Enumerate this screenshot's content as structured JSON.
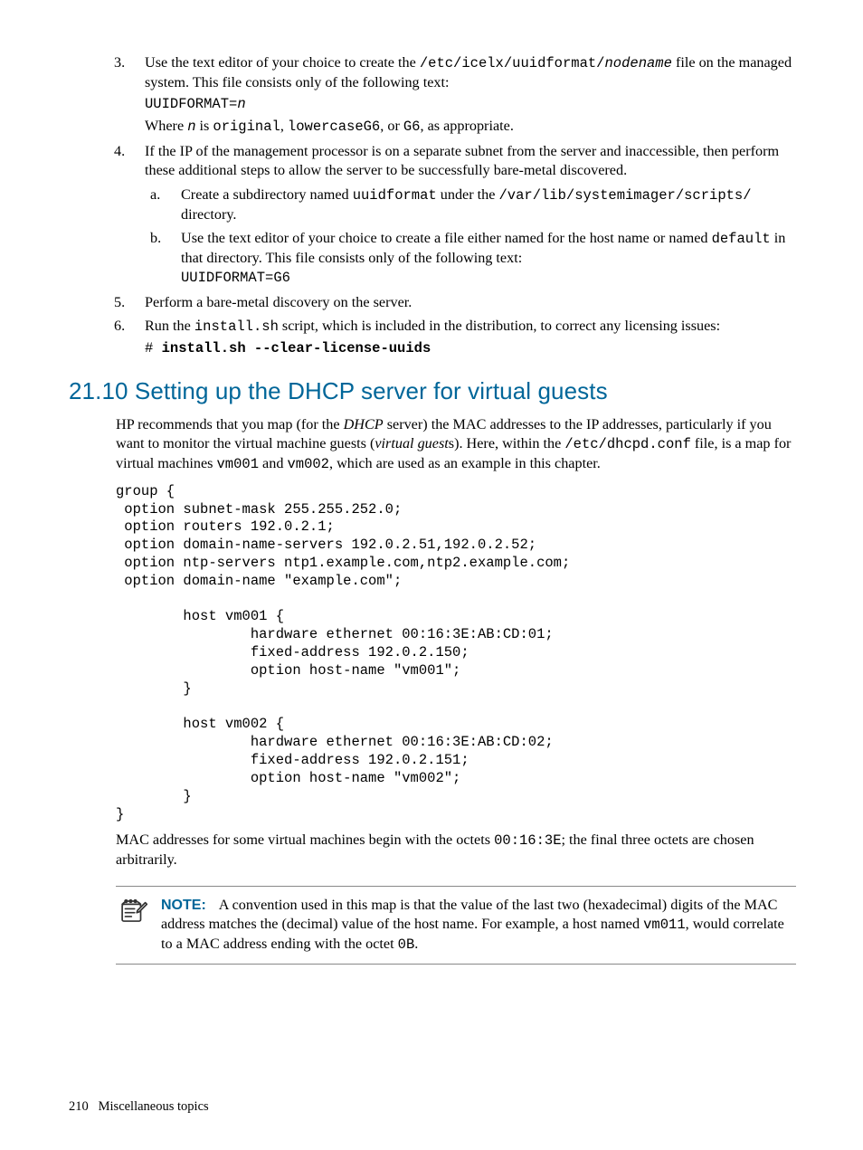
{
  "list": {
    "item3": {
      "line1_a": "Use the text editor of your choice to create the ",
      "line1_b": "/etc/icelx/uuidformat/",
      "line1_c": "nodename",
      "line1_d": " file on the managed system. This file consists only of the following text:",
      "code1_a": "UUIDFORMAT=",
      "code1_b": "n",
      "line2_a": "Where ",
      "line2_b": "n",
      "line2_c": " is ",
      "line2_d": "original",
      "line2_e": ", ",
      "line2_f": "lowercaseG6",
      "line2_g": ", or ",
      "line2_h": "G6",
      "line2_i": ", as appropriate."
    },
    "item4": {
      "intro": "If the IP of the management processor is on a separate subnet from the server and inaccessible, then perform these additional steps to allow the server to be successfully bare-metal discovered.",
      "sub_a": {
        "a": "Create a subdirectory named ",
        "b": "uuidformat",
        "c": " under the ",
        "d": "/var/lib/systemimager/scripts/",
        "e": " directory."
      },
      "sub_b": {
        "a": "Use the text editor of your choice to create a file either named for the host name or named ",
        "b": "default",
        "c": " in that directory. This file consists only of the following text:",
        "code": "UUIDFORMAT=G6"
      }
    },
    "item5": "Perform a bare-metal discovery on the server.",
    "item6": {
      "a": "Run the ",
      "b": "install.sh",
      "c": " script, which is included in the distribution, to correct any licensing issues:",
      "code_a": "# ",
      "code_b": "install.sh --clear-license-uuids"
    }
  },
  "section": {
    "heading": "21.10 Setting up the DHCP server for virtual guests",
    "p1_a": "HP recommends that you map (for the ",
    "p1_b": "DHCP",
    "p1_c": " server) the MAC addresses to the IP addresses, particularly if you want to monitor the virtual machine guests (",
    "p1_d": "virtual guest",
    "p1_e": "s). Here, within the ",
    "p1_f": "/etc/dhcpd.conf",
    "p1_g": " file, is a map for virtual machines ",
    "p1_h": "vm001",
    "p1_i": " and ",
    "p1_j": "vm002",
    "p1_k": ", which are used as an example in this chapter.",
    "codeblock": "group {\n option subnet-mask 255.255.252.0;\n option routers 192.0.2.1;\n option domain-name-servers 192.0.2.51,192.0.2.52;\n option ntp-servers ntp1.example.com,ntp2.example.com;\n option domain-name \"example.com\";\n\n        host vm001 {\n                hardware ethernet 00:16:3E:AB:CD:01;\n                fixed-address 192.0.2.150;\n                option host-name \"vm001\";\n        }\n\n        host vm002 {\n                hardware ethernet 00:16:3E:AB:CD:02;\n                fixed-address 192.0.2.151;\n                option host-name \"vm002\";\n        }\n}",
    "p2_a": "MAC addresses for some virtual machines begin with the octets ",
    "p2_b": "00:16:3E",
    "p2_c": "; the final three octets are chosen arbitrarily."
  },
  "note": {
    "label": "NOTE:",
    "a": "A convention used in this map is that the value of the last two (hexadecimal) digits of the MAC address matches the (decimal) value of the host name. For example, a host named ",
    "b": "vm011",
    "c": ", would correlate to a MAC address ending with the octet ",
    "d": "0B",
    "e": "."
  },
  "footer": {
    "page": "210",
    "title": "Miscellaneous topics"
  }
}
